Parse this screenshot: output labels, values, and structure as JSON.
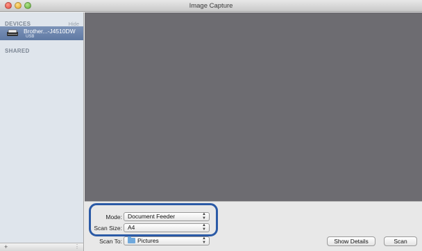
{
  "window": {
    "title": "Image Capture"
  },
  "sidebar": {
    "devices_header": "DEVICES",
    "hide_label": "Hide",
    "device": {
      "name": "Brother...-J4510DW",
      "connection": "USB",
      "icon": "scanner-icon"
    },
    "shared_header": "SHARED",
    "add_icon": "+",
    "resize_icon": "resize-handle-icon"
  },
  "panel": {
    "mode": {
      "label": "Mode:",
      "value": "Document Feeder"
    },
    "scan_size": {
      "label": "Scan Size:",
      "value": "A4"
    },
    "scan_to": {
      "label": "Scan To:",
      "value": "Pictures",
      "icon": "folder-icon"
    },
    "show_details_label": "Show Details",
    "scan_label": "Scan"
  },
  "colors": {
    "preview_background": "#6d6c71",
    "sidebar_selection": "#6a82ab",
    "highlight_outline": "#2b5aa6"
  }
}
